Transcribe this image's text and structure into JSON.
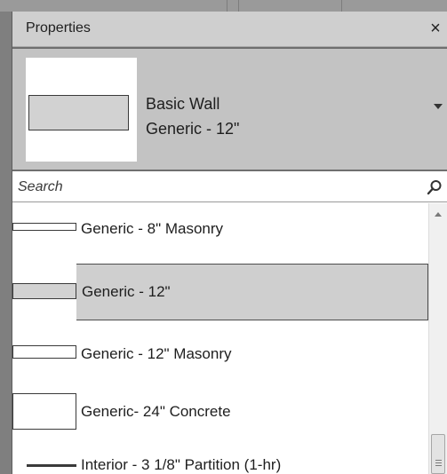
{
  "panel": {
    "title": "Properties",
    "close_glyph": "×"
  },
  "type_selector": {
    "family": "Basic Wall",
    "type": "Generic - 12\""
  },
  "search": {
    "placeholder": "Search",
    "icon": "search-icon"
  },
  "type_list": {
    "items": [
      {
        "label": "Generic - 8\" Masonry",
        "selected": false,
        "thumb": "thin-rectangle"
      },
      {
        "label": "Generic - 12\"",
        "selected": true,
        "thumb": "filled-rectangle"
      },
      {
        "label": "Generic - 12\" Masonry",
        "selected": false,
        "thumb": "rectangle"
      },
      {
        "label": "Generic- 24\" Concrete",
        "selected": false,
        "thumb": "tall-rectangle"
      },
      {
        "label": "Interior - 3 1/8\" Partition (1-hr)",
        "selected": false,
        "thumb": "thick-line"
      }
    ]
  },
  "colors": {
    "titlebar": "#cfcfcf",
    "selector_bg": "#c3c3c3",
    "selected_row": "#cfcfcf",
    "frame": "#8c8c8c"
  }
}
